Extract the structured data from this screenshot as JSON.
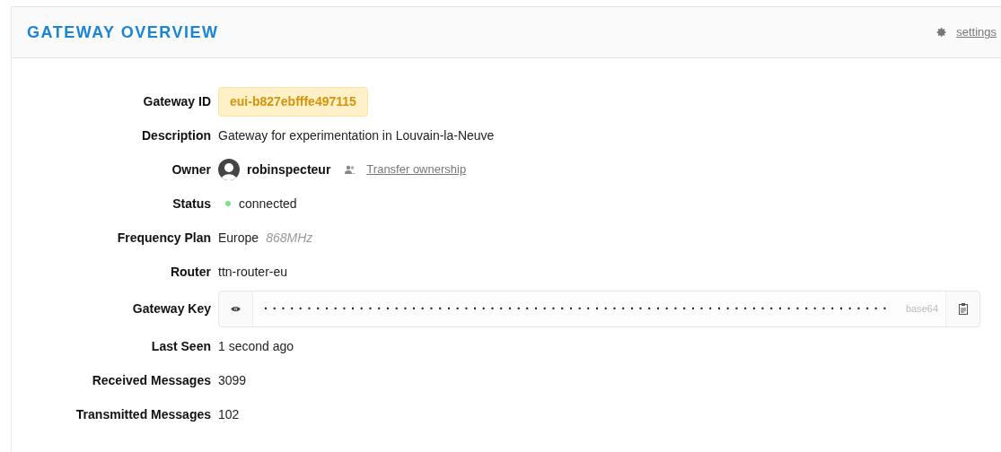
{
  "header": {
    "title": "GATEWAY OVERVIEW",
    "settings_link": "settings"
  },
  "fields": [
    {
      "kind": "badge",
      "label": "Gateway ID",
      "value": "eui-b827ebfffe497115"
    },
    {
      "kind": "text",
      "label": "Description",
      "value": "Gateway for experimentation in Louvain-la-Neuve"
    },
    {
      "kind": "owner",
      "label": "Owner",
      "value": "robinspecteur",
      "link": "Transfer ownership"
    },
    {
      "kind": "status",
      "label": "Status",
      "value": "connected",
      "color": "#7be387"
    },
    {
      "kind": "frequency",
      "label": "Frequency Plan",
      "value": "Europe",
      "note": "868MHz"
    },
    {
      "kind": "text",
      "label": "Router",
      "value": "ttn-router-eu"
    },
    {
      "kind": "key",
      "label": "Gateway Key",
      "value": "········································································",
      "encoding": "base64"
    },
    {
      "kind": "text",
      "label": "Last Seen",
      "value": "1 second ago"
    },
    {
      "kind": "text",
      "label": "Received Messages",
      "value": "3099"
    },
    {
      "kind": "text",
      "label": "Transmitted Messages",
      "value": "102"
    }
  ]
}
